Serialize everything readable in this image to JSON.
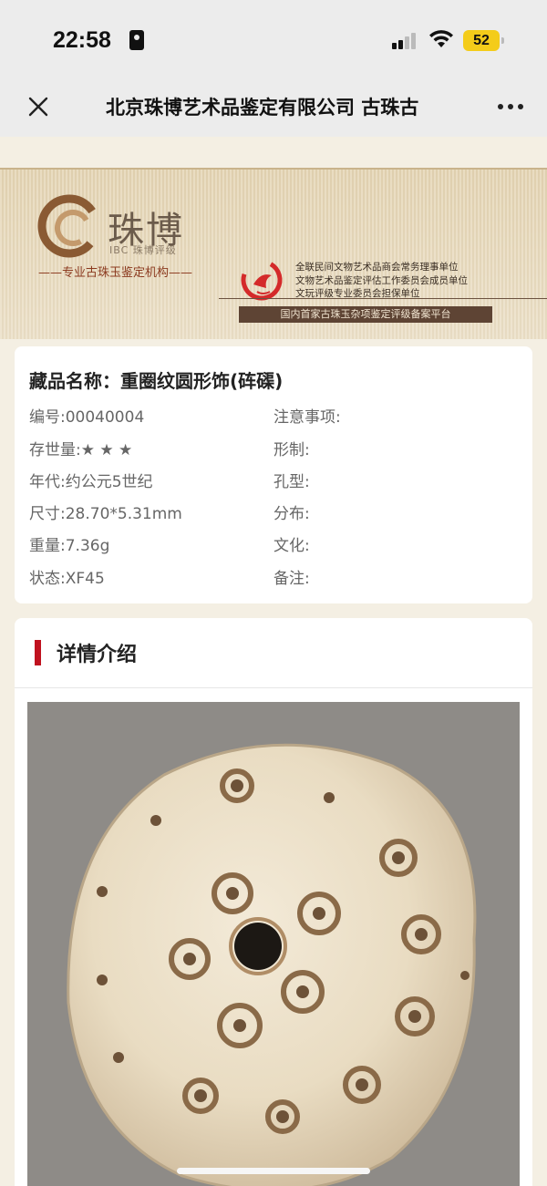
{
  "status_bar": {
    "time": "22:58",
    "battery": "52",
    "battery_color": "#f4cc1a"
  },
  "nav": {
    "title": "北京珠博艺术品鉴定有限公司 古珠古",
    "close_icon": "close-icon",
    "more_icon": "more-icon"
  },
  "banner": {
    "logo_name": "珠博",
    "logo_sub": "IBC 珠博评级",
    "slogan": "——专业古珠玉鉴定机构——",
    "cert_lines": [
      "全联民间文物艺术品商会常务理事单位",
      "文物艺术品鉴定评估工作委员会成员单位",
      "文玩评级专业委员会担保单位"
    ],
    "platform": "国内首家古珠玉杂项鉴定评级备案平台"
  },
  "info": {
    "name": "藏品名称：重圈纹圆形饰(砗磲)",
    "left_fields": [
      "编号:00040004",
      "存世量:★ ★ ★",
      "年代:约公元5世纪",
      "尺寸:28.70*5.31mm",
      "重量:7.36g",
      "状态:XF45"
    ],
    "right_fields": [
      "注意事项:",
      "形制:",
      "孔型:",
      "分布:",
      "文化:",
      "备注:"
    ]
  },
  "detail": {
    "title": "详情介绍",
    "accent_color": "#c0121f"
  }
}
